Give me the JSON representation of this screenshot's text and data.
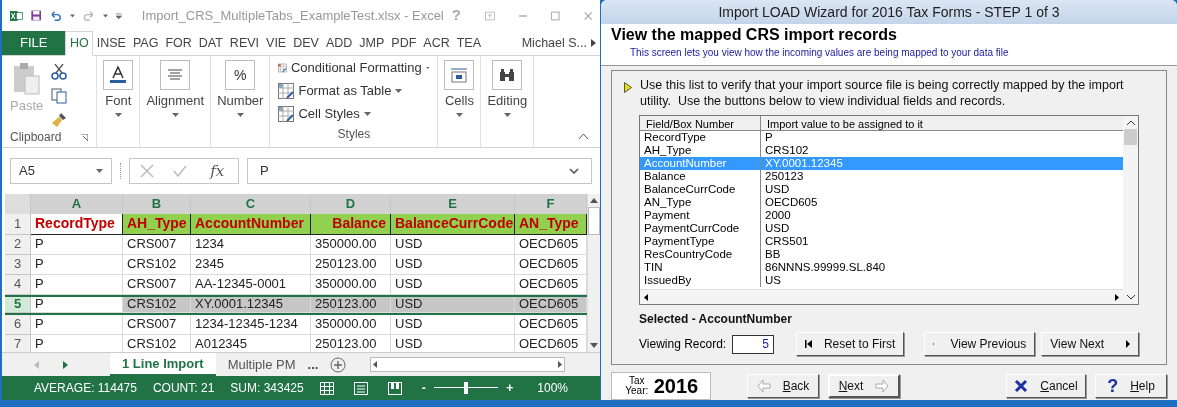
{
  "excel": {
    "title": "Import_CRS_MultipleTabs_ExampleTest.xlsx - Excel",
    "title_buttons": [
      "?"
    ],
    "tabs": [
      {
        "label": "FILE",
        "kind": "file",
        "selected": false
      },
      {
        "label": "HO",
        "kind": "tab",
        "selected": true
      },
      {
        "label": "INSE",
        "kind": "tab",
        "selected": false
      },
      {
        "label": "PAG",
        "kind": "tab",
        "selected": false
      },
      {
        "label": "FOR",
        "kind": "tab",
        "selected": false
      },
      {
        "label": "DAT",
        "kind": "tab",
        "selected": false
      },
      {
        "label": "REVI",
        "kind": "tab",
        "selected": false
      },
      {
        "label": "VIE",
        "kind": "tab",
        "selected": false
      },
      {
        "label": "DEV",
        "kind": "tab",
        "selected": false
      },
      {
        "label": "ADD",
        "kind": "tab",
        "selected": false
      },
      {
        "label": "JMP",
        "kind": "tab",
        "selected": false
      },
      {
        "label": "PDF",
        "kind": "tab",
        "selected": false
      },
      {
        "label": "ACR",
        "kind": "tab",
        "selected": false
      },
      {
        "label": "TEA",
        "kind": "tab",
        "selected": false
      }
    ],
    "user": "Michael S...",
    "ribbon": {
      "paste": "Paste",
      "clipboard": "Clipboard",
      "font": "Font",
      "alignment": "Alignment",
      "number": "Number",
      "percent": "%",
      "styles_items": [
        "Conditional Formatting",
        "Format as Table",
        "Cell Styles"
      ],
      "styles": "Styles",
      "cells": "Cells",
      "editing": "Editing"
    },
    "name_box": "A5",
    "function_label": "fx",
    "formula": "P",
    "columns": [
      "A",
      "B",
      "C",
      "D",
      "E",
      "F"
    ],
    "header_row": {
      "number": "1",
      "cells": [
        "RecordType",
        "AH_Type",
        "AccountNumber",
        "Balance",
        "BalanceCurrCode",
        "AN_Type"
      ]
    },
    "rows": [
      {
        "number": "2",
        "selected": false,
        "cells": [
          "P",
          "CRS007",
          "1234",
          "350000.00",
          "USD",
          "OECD605"
        ]
      },
      {
        "number": "3",
        "selected": false,
        "cells": [
          "P",
          "CRS102",
          "2345",
          "250123.00",
          "USD",
          "OECD605"
        ]
      },
      {
        "number": "4",
        "selected": false,
        "cells": [
          "P",
          "CRS007",
          "AA-12345-0001",
          "350000.00",
          "USD",
          "OECD605"
        ]
      },
      {
        "number": "5",
        "selected": true,
        "cells": [
          "P",
          "CRS102",
          "XY.0001.12345",
          "250123.00",
          "USD",
          "OECD605"
        ]
      },
      {
        "number": "6",
        "selected": false,
        "cells": [
          "P",
          "CRS007",
          "1234-12345-1234",
          "350000.00",
          "USD",
          "OECD605"
        ]
      },
      {
        "number": "7",
        "selected": false,
        "cells": [
          "P",
          "CRS102",
          "A012345",
          "250123.00",
          "USD",
          "OECD605"
        ]
      }
    ],
    "sheets": [
      {
        "label": "1 Line Import",
        "selected": true
      },
      {
        "label": "Multiple PM",
        "selected": false
      }
    ],
    "more_sheets": "...",
    "status": [
      "AVERAGE: 114475",
      "COUNT: 21",
      "SUM: 343425"
    ],
    "zoom": {
      "minus": "-",
      "plus": "+",
      "reading": "100%",
      "level": 0.5
    }
  },
  "wizard": {
    "title": "Import LOAD Wizard for 2016 Tax Forms - STEP 1 of 3",
    "heading": "View the mapped CRS import records",
    "subheading": "This screen lets you view how the incoming values are being mapped to your data file",
    "instructions": "Use this list to verify that your import source file is being correctly mapped by the import utility.  Use the buttons below to view individual fields and records.",
    "list_columns": [
      "Field/Box Number",
      "Import value to be assigned to it"
    ],
    "list_rows": [
      {
        "field": "RecordType",
        "value": "P",
        "selected": false
      },
      {
        "field": "AH_Type",
        "value": "CRS102",
        "selected": false
      },
      {
        "field": "AccountNumber",
        "value": "XY.0001.12345",
        "selected": true
      },
      {
        "field": "Balance",
        "value": "250123",
        "selected": false
      },
      {
        "field": "BalanceCurrCode",
        "value": "USD",
        "selected": false
      },
      {
        "field": "AN_Type",
        "value": "OECD605",
        "selected": false
      },
      {
        "field": "Payment",
        "value": "2000",
        "selected": false
      },
      {
        "field": "PaymentCurrCode",
        "value": "USD",
        "selected": false
      },
      {
        "field": "PaymentType",
        "value": "CRS501",
        "selected": false
      },
      {
        "field": "ResCountryCode",
        "value": "BB",
        "selected": false
      },
      {
        "field": "TIN",
        "value": "86NNNS.99999.SL.840",
        "selected": false
      },
      {
        "field": "IssuedBy",
        "value": "US",
        "selected": false
      }
    ],
    "selected_label": "Selected - AccountNumber",
    "viewing_label": "Viewing Record:",
    "viewing_value": "5",
    "record_buttons": [
      "Reset to First",
      "View Previous",
      "View Next"
    ],
    "tax_label": "Tax Year:",
    "tax_year": "2016",
    "nav_buttons": [
      {
        "label": "Back",
        "kind": "back"
      },
      {
        "label": "Next",
        "kind": "next"
      },
      {
        "label": "Cancel",
        "kind": "cancel"
      },
      {
        "label": "Help",
        "kind": "help",
        "icon_text": "?"
      }
    ]
  }
}
